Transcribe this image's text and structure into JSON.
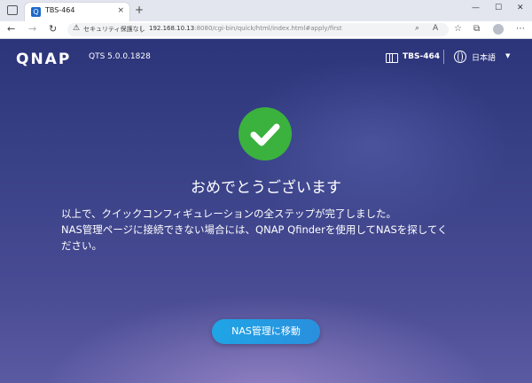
{
  "browser": {
    "tab_title": "TBS-464",
    "security_label": "セキュリティ保護なし",
    "url_host": "192.168.10.13",
    "url_rest": ":8080/cgi-bin/quick/html/index.html#apply/first",
    "new_tab_symbol": "+",
    "close_symbol": "×"
  },
  "header": {
    "logo": "QNAP",
    "version": "QTS 5.0.0.1828",
    "model": "TBS-464",
    "language": "日本語"
  },
  "main": {
    "headline": "おめでとうございます",
    "line1": "以上で、クイックコンフィギュレーションの全ステップが完了しました。",
    "line2": "NAS管理ページに接続できない場合には、QNAP Qfinderを使用してNASを探してく",
    "line3": "ださい。",
    "cta_label": "NAS管理に移動"
  },
  "colors": {
    "accent": "#2a9fe3",
    "success": "#3bb13e",
    "background": "#3a4288"
  }
}
